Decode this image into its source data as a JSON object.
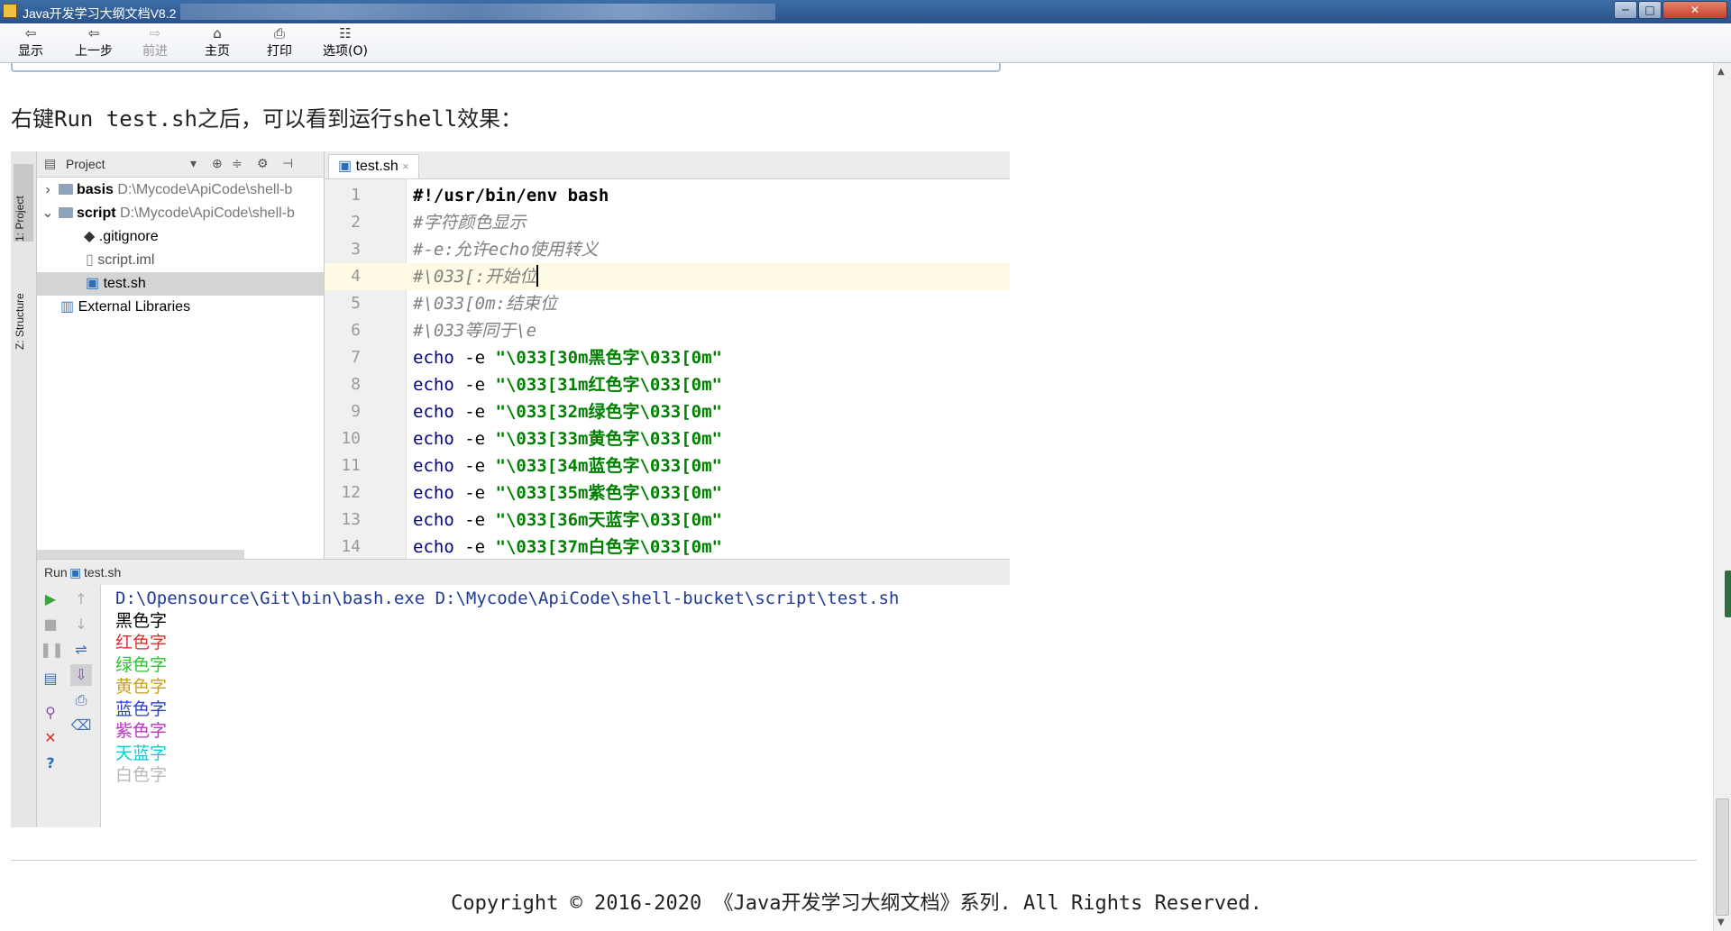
{
  "window": {
    "title": "Java开发学习大纲文档V8.2",
    "min_label": "─",
    "max_label": "□",
    "close_label": "✕"
  },
  "toolbar": {
    "buttons": [
      {
        "label": "显示",
        "icon": "show-icon",
        "glyph": "⇦"
      },
      {
        "label": "上一步",
        "icon": "back-icon",
        "glyph": "⇦"
      },
      {
        "label": "前进",
        "icon": "forward-icon",
        "glyph": "⇨"
      },
      {
        "label": "主页",
        "icon": "home-icon",
        "glyph": "⌂"
      },
      {
        "label": "打印",
        "icon": "print-icon",
        "glyph": "⎙"
      },
      {
        "label": "选项(O)",
        "icon": "options-icon",
        "glyph": "☷"
      }
    ]
  },
  "intro_text": "右键Run test.sh之后，可以看到运行shell效果：",
  "ide": {
    "side_tabs": [
      "1: Project",
      "Z: Structure"
    ],
    "project": {
      "header": "Project",
      "items": [
        {
          "name": "basis",
          "path": "D:\\Mycode\\ApiCode\\shell-b"
        },
        {
          "name": "script",
          "path": "D:\\Mycode\\ApiCode\\shell-b"
        },
        {
          "name": ".gitignore",
          "path": ""
        },
        {
          "name": "script.iml",
          "path": ""
        },
        {
          "name": "test.sh",
          "path": ""
        },
        {
          "name": "External Libraries",
          "path": ""
        }
      ]
    },
    "editor": {
      "tab": "test.sh",
      "tab_close": "×",
      "lines": [
        {
          "n": "1",
          "parts": [
            {
              "t": "#!/usr/bin/env bash",
              "c": "bold"
            }
          ]
        },
        {
          "n": "2",
          "parts": [
            {
              "t": "#字符颜色显示",
              "c": "cm"
            }
          ]
        },
        {
          "n": "3",
          "parts": [
            {
              "t": "#-e:允许echo使用转义",
              "c": "cm"
            }
          ]
        },
        {
          "n": "4",
          "parts": [
            {
              "t": "#\\033[:开始位",
              "c": "cm"
            }
          ]
        },
        {
          "n": "5",
          "parts": [
            {
              "t": "#\\033[0m:结束位",
              "c": "cm"
            }
          ]
        },
        {
          "n": "6",
          "parts": [
            {
              "t": "#\\033等同于\\e",
              "c": "cm"
            }
          ]
        },
        {
          "n": "7",
          "parts": [
            {
              "t": "echo",
              "c": "kw"
            },
            {
              "t": " -e ",
              "c": "plain"
            },
            {
              "t": "\"\\033[30m黑色字\\033[0m\"",
              "c": "str"
            }
          ]
        },
        {
          "n": "8",
          "parts": [
            {
              "t": "echo",
              "c": "kw"
            },
            {
              "t": " -e ",
              "c": "plain"
            },
            {
              "t": "\"\\033[31m红色字\\033[0m\"",
              "c": "str"
            }
          ]
        },
        {
          "n": "9",
          "parts": [
            {
              "t": "echo",
              "c": "kw"
            },
            {
              "t": " -e ",
              "c": "plain"
            },
            {
              "t": "\"\\033[32m绿色字\\033[0m\"",
              "c": "str"
            }
          ]
        },
        {
          "n": "10",
          "parts": [
            {
              "t": "echo",
              "c": "kw"
            },
            {
              "t": " -e ",
              "c": "plain"
            },
            {
              "t": "\"\\033[33m黄色字\\033[0m\"",
              "c": "str"
            }
          ]
        },
        {
          "n": "11",
          "parts": [
            {
              "t": "echo",
              "c": "kw"
            },
            {
              "t": " -e ",
              "c": "plain"
            },
            {
              "t": "\"\\033[34m蓝色字\\033[0m\"",
              "c": "str"
            }
          ]
        },
        {
          "n": "12",
          "parts": [
            {
              "t": "echo",
              "c": "kw"
            },
            {
              "t": " -e ",
              "c": "plain"
            },
            {
              "t": "\"\\033[35m紫色字\\033[0m\"",
              "c": "str"
            }
          ]
        },
        {
          "n": "13",
          "parts": [
            {
              "t": "echo",
              "c": "kw"
            },
            {
              "t": " -e ",
              "c": "plain"
            },
            {
              "t": "\"\\033[36m天蓝字\\033[0m\"",
              "c": "str"
            }
          ]
        },
        {
          "n": "14",
          "parts": [
            {
              "t": "echo",
              "c": "kw"
            },
            {
              "t": " -e ",
              "c": "plain"
            },
            {
              "t": "\"\\033[37m白色字\\033[0m\"",
              "c": "str"
            }
          ]
        }
      ]
    },
    "run": {
      "label": "Run",
      "file": "test.sh",
      "output": [
        {
          "text": "D:\\Opensource\\Git\\bin\\bash.exe D:\\Mycode\\ApiCode\\shell-bucket\\script\\test.sh",
          "color": "#1f3a93"
        },
        {
          "text": "黑色字",
          "color": "#000000"
        },
        {
          "text": "红色字",
          "color": "#e03030"
        },
        {
          "text": "绿色字",
          "color": "#2dc62d"
        },
        {
          "text": "黄色字",
          "color": "#c8a020"
        },
        {
          "text": "蓝色字",
          "color": "#2a3fd8"
        },
        {
          "text": "紫色字",
          "color": "#c030c8"
        },
        {
          "text": "天蓝字",
          "color": "#18c8d0"
        },
        {
          "text": "白色字",
          "color": "#b8b8b8"
        }
      ]
    }
  },
  "footer": "Copyright © 2016-2020 《Java开发学习大纲文档》系列. All Rights Reserved."
}
